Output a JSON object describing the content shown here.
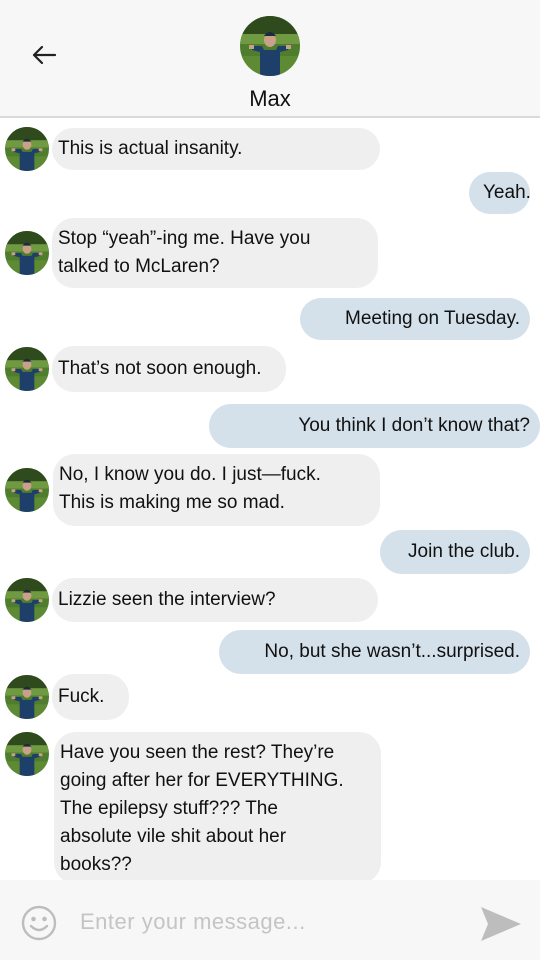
{
  "contact": {
    "name": "Max"
  },
  "messages": [
    {
      "side": "in",
      "lines": [
        "This is actual insanity."
      ]
    },
    {
      "side": "out",
      "lines": [
        "Yeah."
      ]
    },
    {
      "side": "in",
      "lines": [
        "Stop “yeah”-ing me. Have you",
        "talked to McLaren?"
      ]
    },
    {
      "side": "out",
      "lines": [
        "Meeting on Tuesday."
      ]
    },
    {
      "side": "in",
      "lines": [
        "That’s not soon enough."
      ]
    },
    {
      "side": "out",
      "lines": [
        "You think I don’t know that?"
      ]
    },
    {
      "side": "in",
      "lines": [
        "No, I know you do. I just—fuck.",
        "This is making me so mad."
      ]
    },
    {
      "side": "out",
      "lines": [
        "Join the club."
      ]
    },
    {
      "side": "in",
      "lines": [
        "Lizzie seen the interview?"
      ]
    },
    {
      "side": "out",
      "lines": [
        "No, but she wasn’t...surprised."
      ]
    },
    {
      "side": "in",
      "lines": [
        "Fuck."
      ]
    },
    {
      "side": "in",
      "lines": [
        "Have you seen the rest? They’re",
        "going after her for EVERYTHING.",
        "The epilepsy stuff??? The",
        "absolute vile shit about her",
        "books??"
      ]
    }
  ],
  "composer": {
    "placeholder": "Enter your message..."
  },
  "icons": {
    "back": "arrow-left-icon",
    "emoji": "smiley-icon",
    "send": "send-icon"
  },
  "colors": {
    "incoming_bubble": "#efefef",
    "outgoing_bubble": "#d4e0ea",
    "header_bg": "#f7f7f7"
  }
}
